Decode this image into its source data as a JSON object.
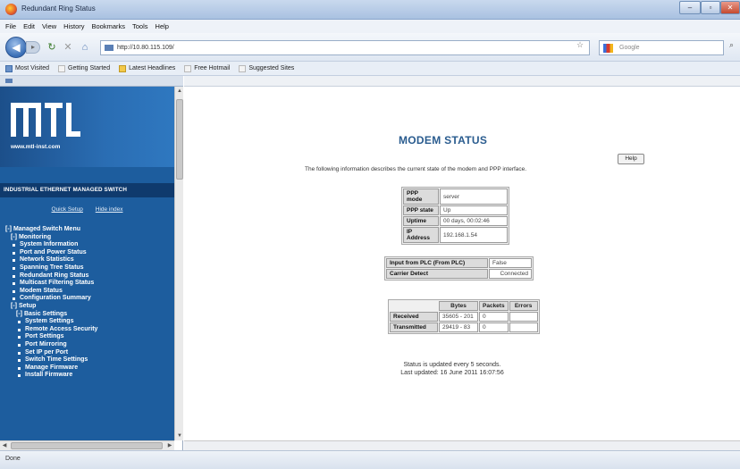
{
  "window": {
    "title": "Redundant Ring Status",
    "min_label": "–",
    "max_label": "▫",
    "close_label": "✕"
  },
  "menubar": {
    "items": [
      "File",
      "Edit",
      "View",
      "History",
      "Bookmarks",
      "Tools",
      "Help"
    ]
  },
  "navbar": {
    "back_label": "◀",
    "forward_label": "▸",
    "url": "http://10.80.115.109/",
    "search_placeholder": "Google"
  },
  "bookmarks": {
    "items": [
      "Most Visited",
      "Getting Started",
      "Latest Headlines",
      "Free Hotmail",
      "Suggested Sites"
    ]
  },
  "left_panel": {
    "website": "www.mtl-inst.com",
    "banner": "INDUSTRIAL ETHERNET MANAGED SWITCH",
    "quick_setup": "Quick Setup",
    "hide_index": "Hide index",
    "menu": {
      "root": "[-] Managed Switch Menu",
      "monitoring": "[-] Monitoring",
      "monitoring_items": [
        "System Information",
        "Port and Power Status",
        "Network Statistics",
        "Spanning Tree Status",
        "Redundant Ring Status",
        "Multicast Filtering Status",
        "Modem Status",
        "Configuration Summary"
      ],
      "setup": "[-] Setup",
      "basic_settings": "[-] Basic Settings",
      "setup_items": [
        "System Settings",
        "Remote Access Security",
        "Port Settings",
        "Port Mirroring",
        "Set IP per Port",
        "Switch Time Settings",
        "Manage Firmware",
        "Install Firmware"
      ]
    }
  },
  "main": {
    "title": "MODEM STATUS",
    "help_label": "Help",
    "intro": "The following information describes the current state of the modem and PPP interface.",
    "ppp_table": [
      {
        "label": "PPP mode",
        "value": "server"
      },
      {
        "label": "PPP state",
        "value": "Up"
      },
      {
        "label": "Uptime",
        "value": "00 days, 00:02:46"
      },
      {
        "label": "IP Address",
        "value": "192.168.1.54"
      }
    ],
    "plc_table": [
      {
        "label": "Input from PLC (From PLC)",
        "value": "False"
      },
      {
        "label": "Carrier Detect",
        "value": "Connected"
      }
    ],
    "traffic_table": {
      "headers": [
        "Bytes",
        "Packets",
        "Errors"
      ],
      "rows": [
        {
          "label": "Received",
          "bytes": "35605 - 201",
          "packets": "0",
          "errors": ""
        },
        {
          "label": "Transmitted",
          "bytes": "29419 - 83",
          "packets": "0",
          "errors": ""
        }
      ]
    },
    "status_note": "Status is updated every 5 seconds.",
    "last_updated": "Last updated: 16 June 2011 16:07:56"
  },
  "statusbar": {
    "text": "Done"
  }
}
